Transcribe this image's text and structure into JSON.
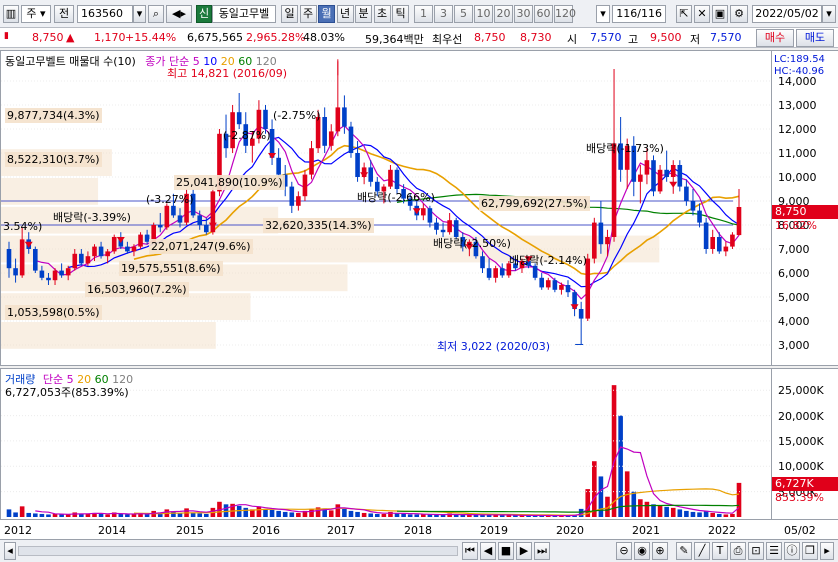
{
  "toolbar": {
    "period": "주",
    "prev": "전",
    "code": "163560",
    "badge": "신",
    "name": "동일고무벨",
    "periods": [
      "일",
      "주",
      "월",
      "년",
      "분",
      "초",
      "틱"
    ],
    "active_period": "월",
    "numbers": [
      "1",
      "3",
      "5",
      "10",
      "20",
      "30",
      "60",
      "120"
    ],
    "count": "116/116",
    "date": "2022/05/02"
  },
  "quote": {
    "price": "8,750",
    "change_sign": "▲",
    "change": "1,170",
    "change_pct": "+15.44%",
    "volume": "6,675,565",
    "volume_pct": "2,965.28%",
    "turnover": "48.03%",
    "amount": "59,364백만",
    "best_ask_label": "최우선",
    "best_ask": "8,750",
    "best_bid": "8,730",
    "open_label": "시",
    "open": "7,570",
    "high_label": "고",
    "high": "9,500",
    "low_label": "저",
    "low": "7,570",
    "buy": "매수",
    "sell": "매도"
  },
  "price_panel": {
    "title": "동일고무벨트 매물대 수(10)",
    "legend_label": "종가 단순",
    "ma_periods": [
      "5",
      "10",
      "20",
      "60",
      "120"
    ],
    "lc": "LC:189.54",
    "hc": "HC:-40.96",
    "current_price": "8,750",
    "current_pct": "16.82%",
    "high_note": "최고 14,821 (2016/09)",
    "low_note": "최저 3,022 (2020/03)",
    "y_ticks": [
      "14,000",
      "13,000",
      "12,000",
      "11,000",
      "10,000",
      "9,000",
      "8,000",
      "7,000",
      "6,000",
      "5,000",
      "4,000",
      "3,000"
    ],
    "volume_profile": [
      "9,877,734(4.3%)",
      "8,522,310(3.7%)",
      "25,041,890(10.9%)",
      "62,799,692(27.5%)",
      "32,620,335(14.3%)",
      "22,071,247(9.6%)",
      "19,575,551(8.6%)",
      "16,503,960(7.2%)",
      "1,053,598(0.5%)"
    ],
    "notes": [
      "3.54%)",
      "배당락(-3.39%)",
      "(-3.27%)",
      "(-2.87%)",
      "(-2.75%)",
      "배당락(-2.66%)",
      "배당락(-2.50%)",
      "배당락(-2.14%)",
      "배당락(-1.73%)"
    ]
  },
  "volume_panel": {
    "legend_label": "거래량",
    "legend_ma": "단순",
    "ma_periods": [
      "5",
      "20",
      "60",
      "120"
    ],
    "summary": "6,727,053주(853.39%)",
    "current_value": "6,727K",
    "current_pct": "853.39%",
    "y_ticks": [
      "25,000K",
      "20,000K",
      "15,000K",
      "10,000K",
      "5,000K"
    ]
  },
  "x_axis": {
    "labels": [
      "2012",
      "2014",
      "2015",
      "2016",
      "2017",
      "2018",
      "2019",
      "2020",
      "2021",
      "2022"
    ],
    "right_label": "05/02"
  },
  "colors": {
    "up": "#e0001a",
    "down": "#0040c8",
    "ma5": "#c000c0",
    "ma10": "#0000ff",
    "ma20": "#e8a000",
    "ma60": "#008000",
    "ma120": "#808080",
    "profile": "#f4e2cc"
  },
  "chart_data": {
    "type": "candlestick",
    "y_range": [
      2500,
      15000
    ],
    "volume_range_k": [
      0,
      28000
    ],
    "candles": [
      [
        7000,
        7300,
        5800,
        6200,
        1500
      ],
      [
        6200,
        6600,
        5600,
        5900,
        900
      ],
      [
        5900,
        7900,
        5800,
        7400,
        2100
      ],
      [
        7400,
        7700,
        6800,
        7000,
        800
      ],
      [
        7000,
        7100,
        6000,
        6100,
        700
      ],
      [
        6100,
        6300,
        5700,
        5800,
        600
      ],
      [
        5800,
        6000,
        5500,
        5700,
        500
      ],
      [
        5700,
        6200,
        5500,
        6100,
        600
      ],
      [
        6100,
        6400,
        5800,
        5900,
        500
      ],
      [
        5900,
        6300,
        5700,
        6200,
        500
      ],
      [
        6200,
        7000,
        6100,
        6800,
        900
      ],
      [
        6800,
        7000,
        6300,
        6400,
        600
      ],
      [
        6400,
        6900,
        6300,
        6700,
        700
      ],
      [
        6700,
        7200,
        6500,
        7100,
        800
      ],
      [
        7100,
        7300,
        6600,
        6700,
        600
      ],
      [
        6700,
        7000,
        6400,
        6900,
        500
      ],
      [
        6900,
        7600,
        6800,
        7500,
        900
      ],
      [
        7500,
        7700,
        7000,
        7100,
        600
      ],
      [
        7100,
        7300,
        6800,
        6900,
        500
      ],
      [
        6900,
        7200,
        6700,
        7100,
        500
      ],
      [
        7100,
        7700,
        7000,
        7600,
        800
      ],
      [
        7600,
        7800,
        7200,
        7300,
        600
      ],
      [
        7300,
        8100,
        7200,
        8000,
        1200
      ],
      [
        8000,
        8500,
        7700,
        7900,
        900
      ],
      [
        7900,
        8900,
        7800,
        8800,
        1500
      ],
      [
        8800,
        9300,
        8300,
        8400,
        1100
      ],
      [
        8400,
        8700,
        7900,
        8100,
        800
      ],
      [
        8100,
        9500,
        8000,
        9300,
        1700
      ],
      [
        9300,
        9500,
        8300,
        8400,
        900
      ],
      [
        8400,
        8600,
        7800,
        8000,
        700
      ],
      [
        8000,
        8300,
        7600,
        7700,
        600
      ],
      [
        7700,
        9600,
        7600,
        9400,
        1800
      ],
      [
        9400,
        12000,
        9200,
        11800,
        3000
      ],
      [
        11800,
        12600,
        10800,
        11200,
        2500
      ],
      [
        11200,
        13000,
        11000,
        12700,
        2600
      ],
      [
        12700,
        13500,
        12000,
        12200,
        2200
      ],
      [
        12200,
        12700,
        11000,
        11300,
        1800
      ],
      [
        11300,
        11900,
        10600,
        11600,
        1500
      ],
      [
        11600,
        13200,
        11400,
        12800,
        2100
      ],
      [
        12800,
        13000,
        11800,
        12000,
        1600
      ],
      [
        12000,
        12400,
        10500,
        10800,
        1400
      ],
      [
        10800,
        11200,
        9800,
        10100,
        1200
      ],
      [
        10100,
        10500,
        9200,
        9600,
        1000
      ],
      [
        9600,
        9800,
        8500,
        8800,
        900
      ],
      [
        8800,
        9400,
        8600,
        9200,
        800
      ],
      [
        9200,
        10300,
        9000,
        10100,
        1200
      ],
      [
        10100,
        11500,
        9900,
        11200,
        1600
      ],
      [
        11200,
        12800,
        11000,
        12500,
        1900
      ],
      [
        12500,
        12900,
        11000,
        11300,
        1700
      ],
      [
        11300,
        12200,
        11100,
        11900,
        1300
      ],
      [
        11900,
        14821,
        11700,
        12900,
        2500
      ],
      [
        12900,
        13400,
        11800,
        12100,
        1600
      ],
      [
        12100,
        12300,
        10800,
        11000,
        1200
      ],
      [
        11000,
        11500,
        9800,
        10000,
        1000
      ],
      [
        10000,
        10600,
        9700,
        10400,
        800
      ],
      [
        10400,
        10700,
        9600,
        9800,
        700
      ],
      [
        9800,
        10000,
        9200,
        9400,
        600
      ],
      [
        9400,
        9700,
        8900,
        9600,
        600
      ],
      [
        9600,
        10500,
        9500,
        10300,
        1000
      ],
      [
        10300,
        10400,
        9300,
        9500,
        700
      ],
      [
        9500,
        9700,
        8900,
        9100,
        600
      ],
      [
        9100,
        9300,
        8600,
        8800,
        500
      ],
      [
        8800,
        9000,
        8200,
        8400,
        500
      ],
      [
        8400,
        8900,
        8200,
        8700,
        600
      ],
      [
        8700,
        8800,
        7900,
        8100,
        500
      ],
      [
        8100,
        8300,
        7600,
        7800,
        400
      ],
      [
        7800,
        8100,
        7500,
        7700,
        400
      ],
      [
        7700,
        8500,
        7600,
        8200,
        700
      ],
      [
        8200,
        8300,
        7400,
        7500,
        500
      ],
      [
        7500,
        7700,
        6900,
        7100,
        400
      ],
      [
        7100,
        7400,
        6700,
        7300,
        400
      ],
      [
        7300,
        7500,
        6600,
        6700,
        400
      ],
      [
        6700,
        6900,
        6000,
        6200,
        500
      ],
      [
        6200,
        6600,
        5700,
        5800,
        500
      ],
      [
        5800,
        6300,
        5600,
        6200,
        400
      ],
      [
        6200,
        6400,
        5800,
        5900,
        300
      ],
      [
        5900,
        6500,
        5800,
        6400,
        400
      ],
      [
        6400,
        6700,
        6100,
        6200,
        300
      ],
      [
        6200,
        6600,
        6000,
        6500,
        300
      ],
      [
        6500,
        6700,
        6200,
        6300,
        300
      ],
      [
        6300,
        6400,
        5700,
        5800,
        300
      ],
      [
        5800,
        6000,
        5300,
        5400,
        300
      ],
      [
        5400,
        5800,
        5300,
        5700,
        300
      ],
      [
        5700,
        5800,
        5200,
        5300,
        200
      ],
      [
        5300,
        5600,
        5100,
        5500,
        300
      ],
      [
        5500,
        5700,
        5000,
        5200,
        300
      ],
      [
        5200,
        5300,
        4200,
        4500,
        500
      ],
      [
        4500,
        4800,
        3022,
        4100,
        1600
      ],
      [
        4100,
        6800,
        4000,
        6600,
        5500
      ],
      [
        6600,
        8300,
        6400,
        8100,
        11000
      ],
      [
        8100,
        9000,
        6800,
        7200,
        8000
      ],
      [
        7200,
        7800,
        6700,
        7500,
        4000
      ],
      [
        7500,
        14500,
        7300,
        11400,
        26000
      ],
      [
        11400,
        12500,
        9800,
        10300,
        20000
      ],
      [
        10300,
        11600,
        9500,
        11300,
        9000
      ],
      [
        11300,
        11700,
        9200,
        9800,
        5000
      ],
      [
        9800,
        10500,
        8900,
        10100,
        3500
      ],
      [
        10100,
        11200,
        9700,
        10700,
        3000
      ],
      [
        10700,
        10900,
        9200,
        9400,
        2500
      ],
      [
        9400,
        10500,
        9300,
        10300,
        2300
      ],
      [
        10300,
        11100,
        9800,
        10000,
        2000
      ],
      [
        10000,
        10700,
        9300,
        10500,
        1800
      ],
      [
        10500,
        10700,
        9400,
        9600,
        1500
      ],
      [
        9600,
        9900,
        8800,
        9000,
        1200
      ],
      [
        9000,
        9500,
        8400,
        8600,
        1000
      ],
      [
        8600,
        8900,
        7900,
        8100,
        900
      ],
      [
        8100,
        8300,
        6800,
        7000,
        1200
      ],
      [
        7000,
        7800,
        6800,
        7500,
        800
      ],
      [
        7500,
        7700,
        6800,
        6900,
        600
      ],
      [
        6900,
        7300,
        6700,
        7100,
        500
      ],
      [
        7100,
        7700,
        7000,
        7600,
        600
      ],
      [
        7580,
        9500,
        7570,
        8750,
        6727
      ]
    ]
  }
}
